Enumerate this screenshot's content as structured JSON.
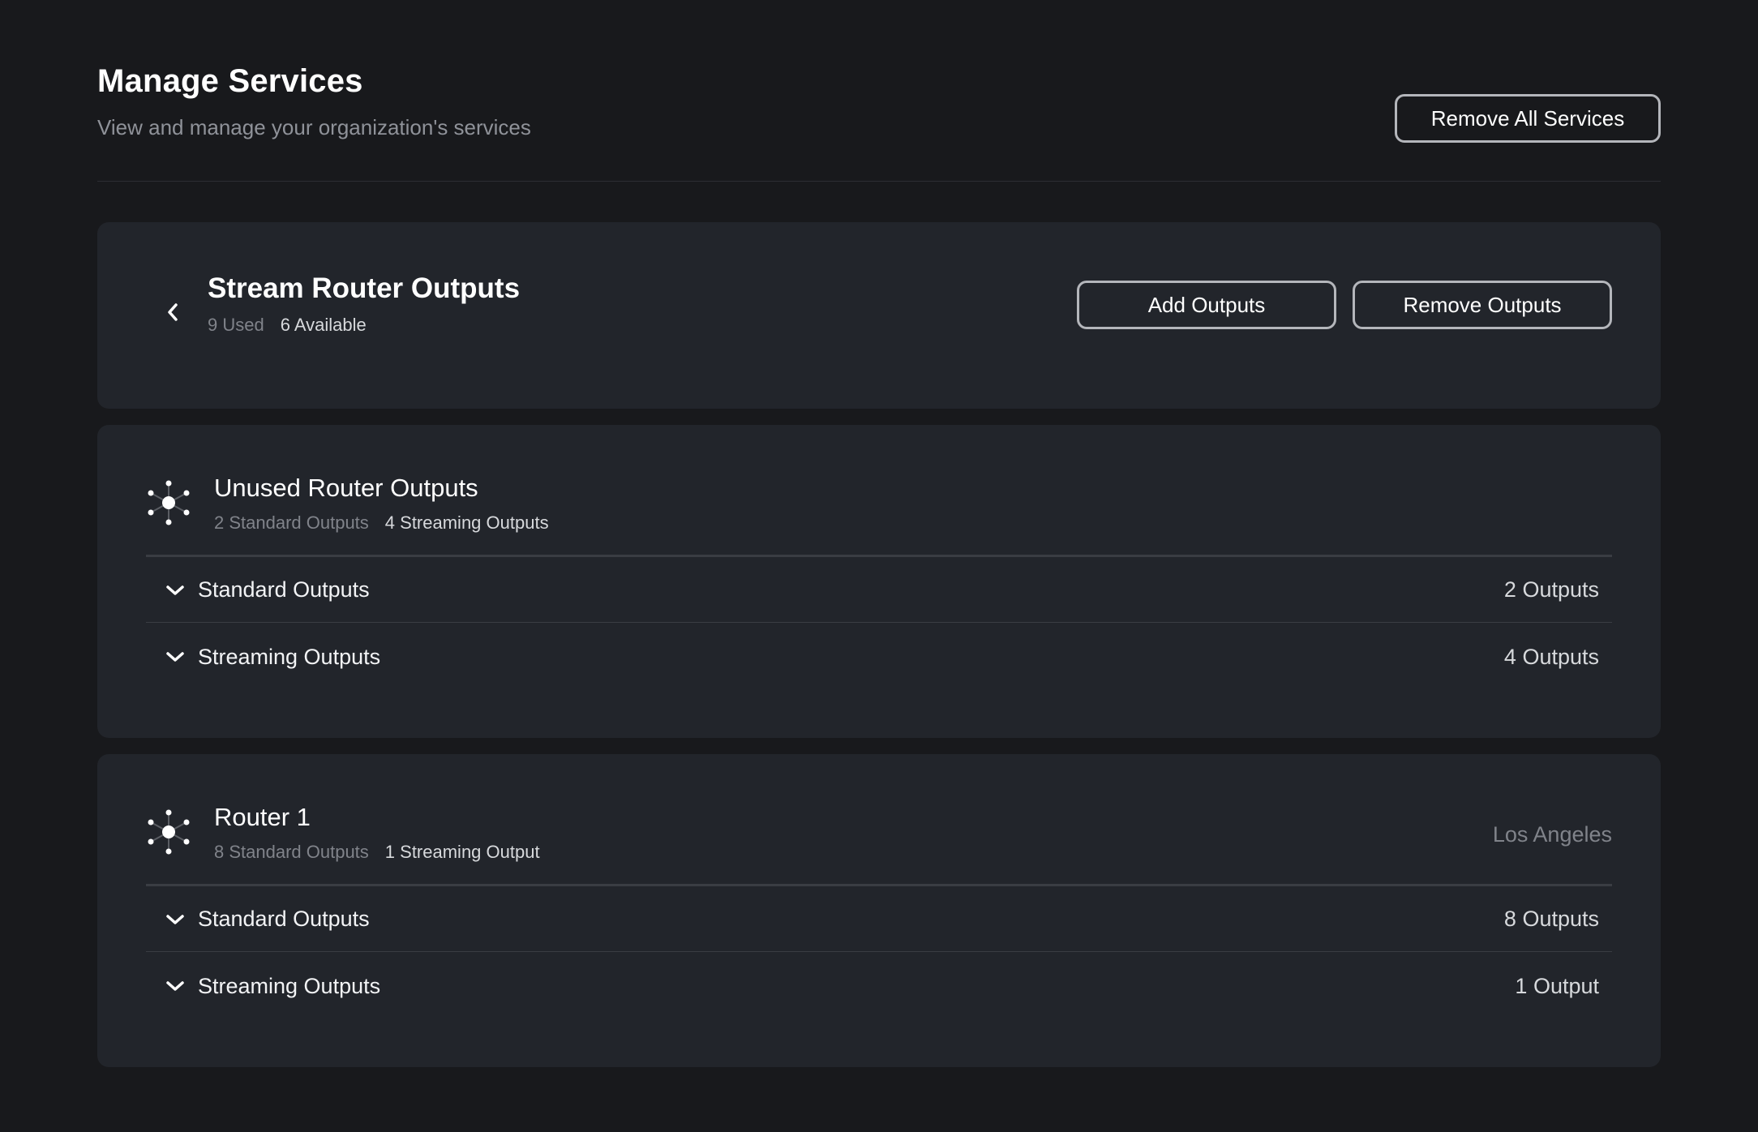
{
  "header": {
    "title": "Manage Services",
    "subtitle": "View and manage your organization's services",
    "remove_all_label": "Remove All Services"
  },
  "service_summary": {
    "title": "Stream Router Outputs",
    "used": "9 Used",
    "available": "6 Available",
    "add_label": "Add Outputs",
    "remove_label": "Remove Outputs"
  },
  "groups": [
    {
      "name": "Unused Router Outputs",
      "standard_summary": "2 Standard Outputs",
      "streaming_summary": "4 Streaming Outputs",
      "location": "",
      "rows": [
        {
          "label": "Standard Outputs",
          "count": "2 Outputs"
        },
        {
          "label": "Streaming Outputs",
          "count": "4 Outputs"
        }
      ]
    },
    {
      "name": "Router 1",
      "standard_summary": "8 Standard Outputs",
      "streaming_summary": "1 Streaming Output",
      "location": "Los Angeles",
      "rows": [
        {
          "label": "Standard Outputs",
          "count": "8 Outputs"
        },
        {
          "label": "Streaming Outputs",
          "count": "1 Output"
        }
      ]
    }
  ],
  "icons": {
    "back": "chevron-left-icon",
    "expand": "chevron-down-icon",
    "router": "router-hub-icon"
  },
  "colors": {
    "background": "#18191c",
    "card": "#22252b",
    "button_border": "#b4b6bb",
    "muted_text": "#80838a"
  }
}
